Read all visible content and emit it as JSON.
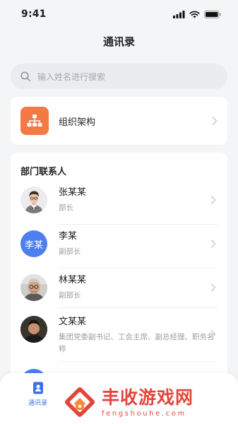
{
  "status": {
    "time": "9:41"
  },
  "nav": {
    "title": "通讯录"
  },
  "search": {
    "placeholder": "输入姓名进行搜索"
  },
  "org": {
    "label": "组织架构",
    "icon": "org-chart-icon",
    "color": "#f37a45"
  },
  "contacts": {
    "section_title": "部门联系人",
    "items": [
      {
        "name": "张某某",
        "role": "部长",
        "avatar": "photo"
      },
      {
        "name": "李某",
        "role": "副部长",
        "avatar": "李某"
      },
      {
        "name": "林某某",
        "role": "副部长",
        "avatar": "photo"
      },
      {
        "name": "文某某",
        "role": "集团党委副书记、工会主席、副总经理、职务名称",
        "avatar": "photo"
      },
      {
        "name": "",
        "role": "",
        "avatar": ""
      }
    ]
  },
  "tabbar": {
    "contacts_label": "通讯录",
    "accent": "#3c6fe8"
  },
  "watermark": {
    "title": "丰收游戏网",
    "url": "fengshouhe.com",
    "color": "#e4453b"
  }
}
